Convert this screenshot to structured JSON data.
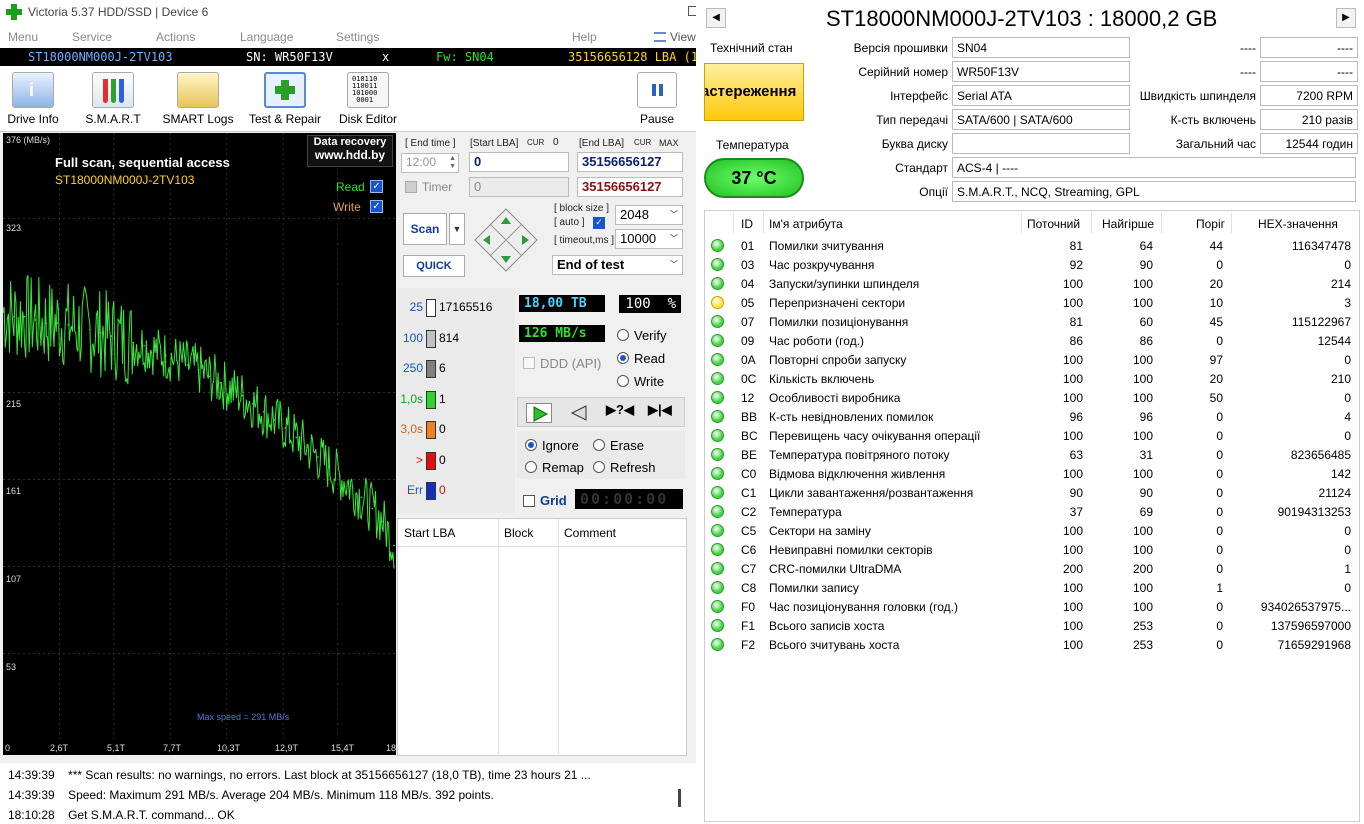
{
  "window": {
    "title": "Victoria 5.37 HDD/SSD | Device 6"
  },
  "menu": [
    "Menu",
    "Service",
    "Actions",
    "Language",
    "Settings",
    "Help",
    "View"
  ],
  "device_bar": {
    "model": "ST18000NM000J-2TV103",
    "sn": "SN: WR50F13V",
    "close": "x",
    "fw": "Fw: SN04",
    "lba": "35156656128 LBA (18"
  },
  "toolbar": {
    "buttons": [
      "Drive Info",
      "S.M.A.R.T",
      "SMART Logs",
      "Test & Repair",
      "Disk Editor",
      "Pause"
    ]
  },
  "graph": {
    "caption": "Full scan, sequential access",
    "model": "ST18000NM000J-2TV103",
    "promo1": "Data recovery",
    "promo2": "www.hdd.by",
    "read_label": "Read",
    "write_label": "Write",
    "max_speed": "Max speed = 291 MB/s",
    "y_unit": "376 (MB/s)",
    "y_ticks": [
      "323",
      "215",
      "161",
      "107",
      "53"
    ],
    "x_ticks": [
      "0",
      "2,6T",
      "5,1T",
      "7,7T",
      "10,3T",
      "12,9T",
      "15,4T",
      "18"
    ]
  },
  "chart_data": {
    "type": "line",
    "title": "Full scan, sequential access",
    "xlabel": "",
    "ylabel": "(MB/s)",
    "ylim": [
      0,
      376
    ],
    "xlim": [
      0,
      18
    ],
    "grid": true,
    "series": [
      {
        "name": "Read",
        "color": "#39e639",
        "x": [
          0,
          0.5,
          1,
          1.5,
          2,
          2.5,
          3,
          3.5,
          4,
          4.5,
          5,
          5.5,
          6,
          6.5,
          7,
          7.5,
          8,
          8.5,
          9,
          9.5,
          10,
          10.5,
          11,
          11.5,
          12,
          12.5,
          13,
          13.5,
          14,
          14.5,
          15,
          15.5,
          16,
          16.5,
          17,
          17.5,
          18
        ],
        "y": [
          265,
          262,
          262,
          260,
          258,
          258,
          257,
          255,
          254,
          252,
          250,
          248,
          246,
          244,
          241,
          238,
          235,
          232,
          229,
          225,
          221,
          217,
          213,
          208,
          203,
          198,
          193,
          187,
          181,
          175,
          169,
          163,
          157,
          150,
          143,
          135,
          120
        ]
      }
    ]
  },
  "control": {
    "end_time_label": "[ End time ]",
    "start_lba_label": "[Start LBA]",
    "cur_label": "CUR",
    "cur_value": "0",
    "end_lba_label": "[End LBA]",
    "cur2_label": "CUR",
    "max_label": "MAX",
    "time_value": "12:00",
    "start_lba": "0",
    "end_lba": "35156656127",
    "timer_label": "Timer",
    "timer_value": "0",
    "end_lba2": "35156656127",
    "scan": "Scan",
    "quick": "QUICK",
    "block_size_label": "[ block size ]",
    "auto_label": "[ auto ]",
    "block_size": "2048",
    "timeout_label": "[ timeout,ms ]",
    "timeout": "10000",
    "end_of_test": "End of test",
    "legend": [
      {
        "label": "25",
        "count": "17165516",
        "color": "#ffffff",
        "label_color": "#1656c8"
      },
      {
        "label": "100",
        "count": "814",
        "color": "#c0c0c0",
        "label_color": "#1656c8"
      },
      {
        "label": "250",
        "count": "6",
        "color": "#808080",
        "label_color": "#1656c8"
      },
      {
        "label": "1,0s",
        "count": "1",
        "color": "#2cd52c",
        "label_color": "#1a9a1a"
      },
      {
        "label": "3,0s",
        "count": "0",
        "color": "#f08020",
        "label_color": "#d06010"
      },
      {
        "label": ">",
        "count": "0",
        "color": "#e01010",
        "label_color": "#d01010"
      },
      {
        "label": "Err",
        "count": "0",
        "color": "#1030c0",
        "label_color": "#1656c8"
      }
    ],
    "capacity": "18,00 TB",
    "percent": "100",
    "percent_sign": "%",
    "speed": "126 MB/s",
    "verify": "Verify",
    "read": "Read",
    "write": "Write",
    "ddd": "DDD (API)",
    "ignore": "Ignore",
    "erase": "Erase",
    "remap": "Remap",
    "refresh": "Refresh",
    "grid": "Grid",
    "timer_display": "00:00:00"
  },
  "log_table": {
    "columns": [
      "Start LBA",
      "Block",
      "Comment"
    ]
  },
  "log": [
    {
      "time": "14:39:39",
      "text": "*** Scan results: no warnings, no errors. Last block at 35156656127 (18,0 TB), time 23 hours 21 ..."
    },
    {
      "time": "14:39:39",
      "text": "Speed: Maximum 291 MB/s. Average 204 MB/s. Minimum 118 MB/s. 392 points."
    },
    {
      "time": "18:10:28",
      "text": "Get S.M.A.R.T. command... OK"
    }
  ],
  "drive": {
    "title": "ST18000NM000J-2TV103 : 18000,2 GB",
    "tech_state_label": "Технічний стан",
    "tech_state": "астереження",
    "temp_label": "Температура",
    "temp": "37 °C",
    "fields": [
      {
        "label": "Версія прошивки",
        "value": "SN04"
      },
      {
        "label": "Серійний номер",
        "value": "WR50F13V"
      },
      {
        "label": "Інтерфейс",
        "value": "Serial ATA"
      },
      {
        "label": "Тип передачі",
        "value": "SATA/600 | SATA/600"
      },
      {
        "label": "Буква диску",
        "value": ""
      },
      {
        "label": "Стандарт",
        "value": "ACS-4 | ----"
      },
      {
        "label": "Опції",
        "value": "S.M.A.R.T., NCQ, Streaming, GPL"
      }
    ],
    "right_fields": [
      {
        "label": "----",
        "value": "----"
      },
      {
        "label": "----",
        "value": "----"
      },
      {
        "label": "Швидкість шпинделя",
        "value": "7200 RPM"
      },
      {
        "label": "К-сть включень",
        "value": "210 разів"
      },
      {
        "label": "Загальний час",
        "value": "12544 годин"
      }
    ]
  },
  "smart": {
    "headers": [
      "ID",
      "Ім'я атрибута",
      "Поточний",
      "Найгірше",
      "Поріг",
      "HEX-значення"
    ],
    "rows": [
      {
        "id": "01",
        "name": "Помилки зчитування",
        "cur": "81",
        "worst": "64",
        "thr": "44",
        "raw": "116347478",
        "status": "ok"
      },
      {
        "id": "03",
        "name": "Час розкручування",
        "cur": "92",
        "worst": "90",
        "thr": "0",
        "raw": "0",
        "status": "ok"
      },
      {
        "id": "04",
        "name": "Запуски/зупинки шпинделя",
        "cur": "100",
        "worst": "100",
        "thr": "20",
        "raw": "214",
        "status": "ok"
      },
      {
        "id": "05",
        "name": "Перепризначені сектори",
        "cur": "100",
        "worst": "100",
        "thr": "10",
        "raw": "3",
        "status": "warn"
      },
      {
        "id": "07",
        "name": "Помилки позиціонування",
        "cur": "81",
        "worst": "60",
        "thr": "45",
        "raw": "115122967",
        "status": "ok"
      },
      {
        "id": "09",
        "name": "Час роботи (год.)",
        "cur": "86",
        "worst": "86",
        "thr": "0",
        "raw": "12544",
        "status": "ok"
      },
      {
        "id": "0A",
        "name": "Повторні спроби запуску",
        "cur": "100",
        "worst": "100",
        "thr": "97",
        "raw": "0",
        "status": "ok"
      },
      {
        "id": "0C",
        "name": "Кількість включень",
        "cur": "100",
        "worst": "100",
        "thr": "20",
        "raw": "210",
        "status": "ok"
      },
      {
        "id": "12",
        "name": "Особливості виробника",
        "cur": "100",
        "worst": "100",
        "thr": "50",
        "raw": "0",
        "status": "ok"
      },
      {
        "id": "BB",
        "name": "К-сть невідновлених помилок",
        "cur": "96",
        "worst": "96",
        "thr": "0",
        "raw": "4",
        "status": "ok"
      },
      {
        "id": "BC",
        "name": "Перевищень часу очікування операції",
        "cur": "100",
        "worst": "100",
        "thr": "0",
        "raw": "0",
        "status": "ok"
      },
      {
        "id": "BE",
        "name": "Температура повітряного потоку",
        "cur": "63",
        "worst": "31",
        "thr": "0",
        "raw": "823656485",
        "status": "ok"
      },
      {
        "id": "C0",
        "name": "Відмова відключення живлення",
        "cur": "100",
        "worst": "100",
        "thr": "0",
        "raw": "142",
        "status": "ok"
      },
      {
        "id": "C1",
        "name": "Цикли завантаження/розвантаження",
        "cur": "90",
        "worst": "90",
        "thr": "0",
        "raw": "21124",
        "status": "ok"
      },
      {
        "id": "C2",
        "name": "Температура",
        "cur": "37",
        "worst": "69",
        "thr": "0",
        "raw": "90194313253",
        "status": "ok"
      },
      {
        "id": "C5",
        "name": "Сектори на заміну",
        "cur": "100",
        "worst": "100",
        "thr": "0",
        "raw": "0",
        "status": "ok"
      },
      {
        "id": "C6",
        "name": "Невиправні помилки секторів",
        "cur": "100",
        "worst": "100",
        "thr": "0",
        "raw": "0",
        "status": "ok"
      },
      {
        "id": "C7",
        "name": "CRC-помилки UltraDMA",
        "cur": "200",
        "worst": "200",
        "thr": "0",
        "raw": "1",
        "status": "ok"
      },
      {
        "id": "C8",
        "name": "Помилки запису",
        "cur": "100",
        "worst": "100",
        "thr": "1",
        "raw": "0",
        "status": "ok"
      },
      {
        "id": "F0",
        "name": "Час позиціонування головки (год.)",
        "cur": "100",
        "worst": "100",
        "thr": "0",
        "raw": "934026537975...",
        "status": "ok"
      },
      {
        "id": "F1",
        "name": "Всього записів хоста",
        "cur": "100",
        "worst": "253",
        "thr": "0",
        "raw": "137596597000",
        "status": "ok"
      },
      {
        "id": "F2",
        "name": "Всього зчитувань хоста",
        "cur": "100",
        "worst": "253",
        "thr": "0",
        "raw": "71659291968",
        "status": "ok"
      }
    ]
  },
  "colors": {
    "ok_dot": "#43d443",
    "warn_dot": "#ffe23a",
    "temp_badge": "#3ce03c",
    "state_badge": "#ffd21a"
  }
}
